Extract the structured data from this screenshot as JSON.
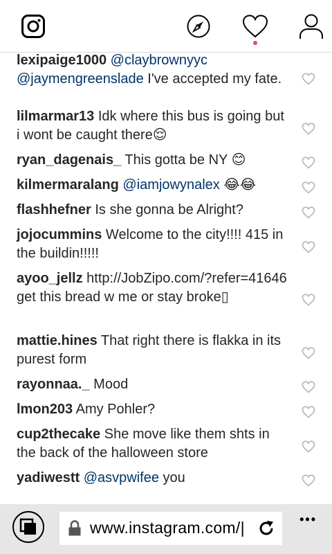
{
  "comments": [
    {
      "user": "lexipaige1000",
      "parts": [
        {
          "t": "@claybrownyyc",
          "m": true
        },
        {
          "t": " ",
          "m": false
        },
        {
          "t": "@jaymengreenslade",
          "m": true
        },
        {
          "t": " I've accepted my fate.",
          "m": false
        }
      ]
    },
    {
      "user": "lilmarmar13",
      "parts": [
        {
          "t": "Idk where this bus is going but i wont be caught there😌",
          "m": false
        }
      ]
    },
    {
      "user": "ryan_dagenais_",
      "parts": [
        {
          "t": "This gotta be NY 😊",
          "m": false
        }
      ]
    },
    {
      "user": "kilmermaralang",
      "parts": [
        {
          "t": "@iamjowynalex",
          "m": true
        },
        {
          "t": " 😂😂",
          "m": false
        }
      ]
    },
    {
      "user": "flashhefner",
      "parts": [
        {
          "t": "Is she gonna be Alright?",
          "m": false
        }
      ]
    },
    {
      "user": "jojocummins",
      "parts": [
        {
          "t": "Welcome to the city!!!! 415 in the buildin!!!!!",
          "m": false
        }
      ]
    },
    {
      "user": "ayoo_jellz",
      "parts": [
        {
          "t": "http://JobZipo.com/?refer=41646 get this bread w me or stay broke▯",
          "m": false
        }
      ]
    },
    {
      "user": "mattie.hines",
      "parts": [
        {
          "t": "That right there is flakka in its purest form",
          "m": false
        }
      ]
    },
    {
      "user": "rayonnaa._",
      "parts": [
        {
          "t": "Mood",
          "m": false
        }
      ]
    },
    {
      "user": "lmon203",
      "parts": [
        {
          "t": "Amy Pohler?",
          "m": false
        }
      ]
    },
    {
      "user": "cup2thecake",
      "parts": [
        {
          "t": "She move like them shts in the back of the halloween store",
          "m": false
        }
      ]
    },
    {
      "user": "yadiwestt",
      "parts": [
        {
          "t": "@asvpwifee",
          "m": true
        },
        {
          "t": " you",
          "m": false
        }
      ]
    }
  ],
  "browser": {
    "url": "www.instagram.com/|"
  },
  "colors": {
    "mention": "#003569",
    "notification": "#ed4956",
    "browser_bar": "#e6e6e6"
  },
  "icons": {
    "logo": "instagram-logo-icon",
    "explore": "compass-icon",
    "activity": "heart-icon",
    "profile": "person-icon",
    "like": "heart-outline-icon",
    "tabs": "tabs-icon",
    "lock": "lock-icon",
    "refresh": "refresh-icon",
    "more": "more-dots-icon"
  }
}
